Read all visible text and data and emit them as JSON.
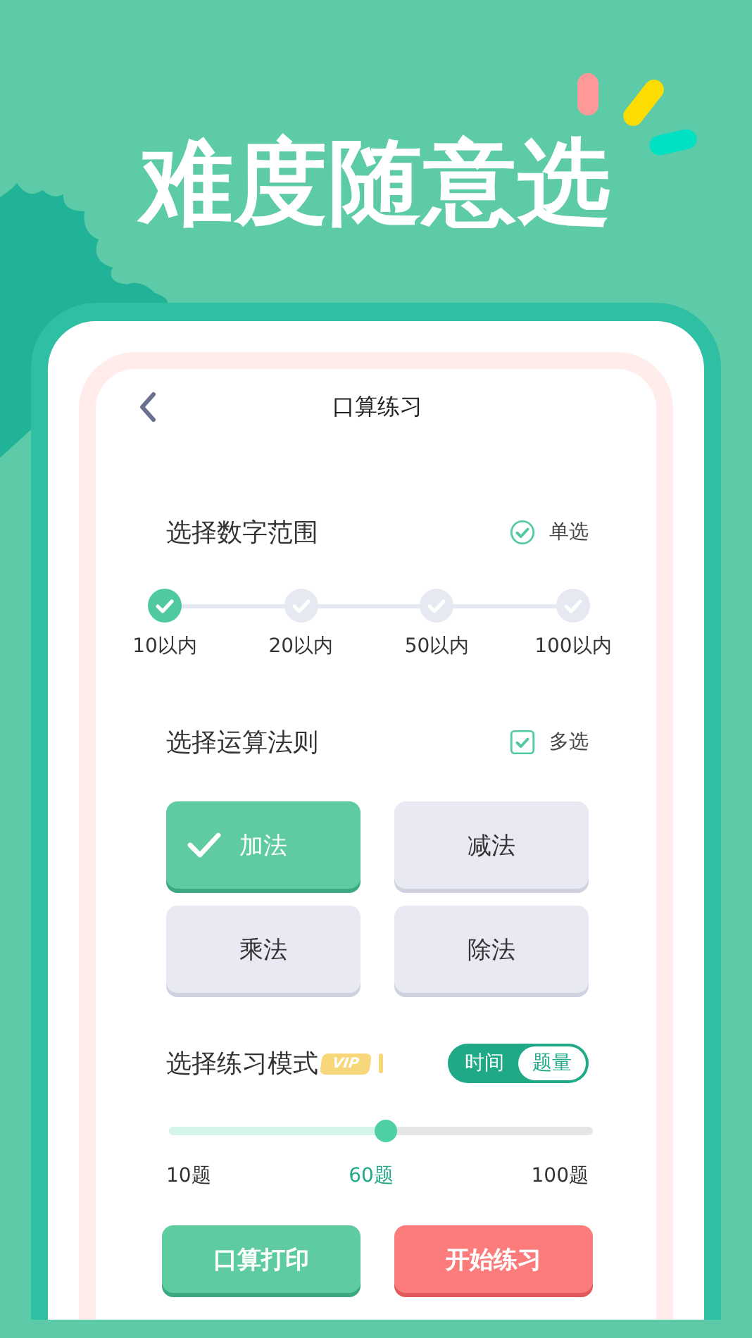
{
  "headline": "难度随意选",
  "screen": {
    "title": "口算练习"
  },
  "range": {
    "heading": "选择数字范围",
    "mode": {
      "kind": "circle",
      "label": "单选"
    },
    "options": [
      {
        "label": "10以内",
        "selected": true
      },
      {
        "label": "20以内",
        "selected": false
      },
      {
        "label": "50以内",
        "selected": false
      },
      {
        "label": "100以内",
        "selected": false
      }
    ]
  },
  "operations": {
    "heading": "选择运算法则",
    "mode": {
      "kind": "square",
      "label": "多选"
    },
    "options": [
      {
        "label": "加法",
        "selected": true
      },
      {
        "label": "减法",
        "selected": false
      },
      {
        "label": "乘法",
        "selected": false
      },
      {
        "label": "除法",
        "selected": false
      }
    ]
  },
  "practice_mode": {
    "heading": "选择练习模式",
    "badge": "VIP",
    "toggle": [
      {
        "label": "时间",
        "selected": false
      },
      {
        "label": "题量",
        "selected": true
      }
    ],
    "slider": {
      "level": 0.51
    },
    "marks": [
      {
        "label": "10题",
        "selected": false
      },
      {
        "label": "60题",
        "selected": true
      },
      {
        "label": "100题",
        "selected": false
      }
    ]
  },
  "buttons": [
    {
      "label": "口算打印",
      "kind": "secondary"
    },
    {
      "label": "开始练习",
      "kind": "primary"
    }
  ]
}
